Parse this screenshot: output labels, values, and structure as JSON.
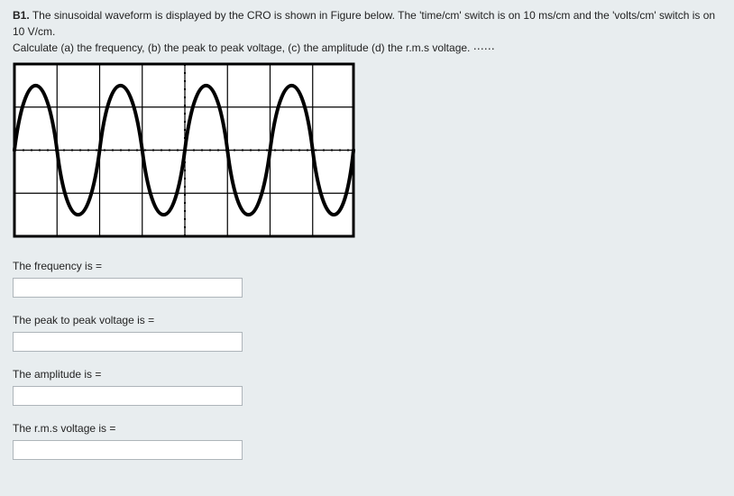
{
  "question": {
    "number": "B1.",
    "text_line1": "The sinusoidal waveform is displayed by the CRO is shown in Figure below. The 'time/cm'  switch is on 10 ms/cm and the 'volts/cm' switch is on 10 V/cm.",
    "text_line2": "Calculate (a) the frequency, (b) the peak to peak voltage, (c) the amplitude  (d) the r.m.s voltage."
  },
  "oscilloscope": {
    "grid_cols": 8,
    "grid_rows": 4,
    "cycles_visible": 4,
    "amplitude_divisions": 2,
    "time_per_div_ms": 10,
    "volts_per_div": 10
  },
  "answers": [
    {
      "label": "The frequency is =",
      "value": ""
    },
    {
      "label": "The peak to peak voltage is =",
      "value": ""
    },
    {
      "label": "The amplitude is =",
      "value": ""
    },
    {
      "label": "The r.m.s voltage is =",
      "value": ""
    }
  ],
  "hint_glyph": "⋯⋯"
}
